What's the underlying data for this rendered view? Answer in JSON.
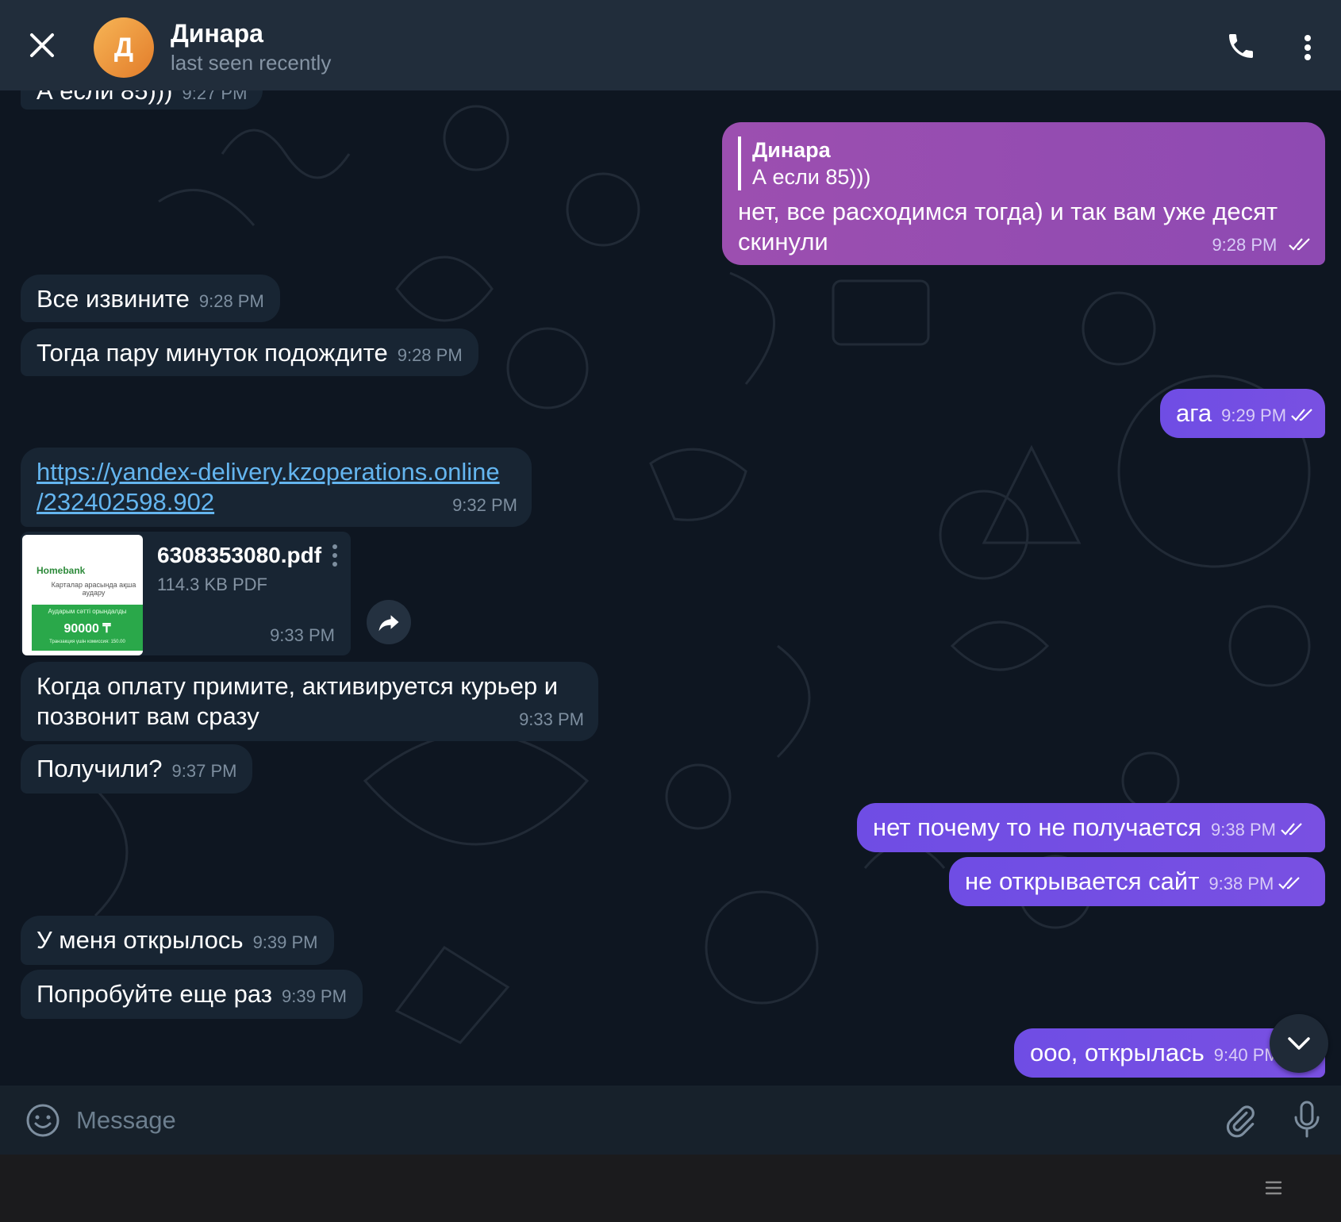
{
  "header": {
    "avatar_letter": "Д",
    "contact_name": "Динара",
    "status": "last seen recently"
  },
  "messages": [
    {
      "dir": "in",
      "text": "А если 85)))",
      "time": "9:27 PM"
    },
    {
      "dir": "out",
      "reply_name": "Динара",
      "reply_text": "А если 85)))",
      "text": "нет, все расходимся тогда) и так вам уже десят скинули",
      "time": "9:28 PM"
    },
    {
      "dir": "in",
      "text": "Все извините",
      "time": "9:28 PM"
    },
    {
      "dir": "in",
      "text": "Тогда пару минуток подождите",
      "time": "9:28 PM"
    },
    {
      "dir": "out",
      "text": "ага",
      "time": "9:29 PM"
    },
    {
      "dir": "in",
      "link_line1": "https://yandex-delivery.kzoperations.online",
      "link_line2": "/232402598.902",
      "time": "9:32 PM"
    },
    {
      "dir": "in",
      "file_name": "6308353080.pdf",
      "file_size": "114.3 KB PDF",
      "time": "9:33 PM",
      "thumb_brand": "Homebank",
      "thumb_text": "Карталар арасында ақша аудару",
      "thumb_status": "Аударым сәтті орындалды",
      "thumb_amount": "90000 ₸",
      "thumb_fee": "Транзакция үшін комиссия: 150.00"
    },
    {
      "dir": "in",
      "text_line1": "Когда оплату примите, активируется курьер и",
      "text_line2": "позвонит вам сразу",
      "time": "9:33 PM"
    },
    {
      "dir": "in",
      "text": "Получили?",
      "time": "9:37 PM"
    },
    {
      "dir": "out",
      "text": "нет почему то не получается",
      "time": "9:38 PM"
    },
    {
      "dir": "out",
      "text": "не открывается сайт",
      "time": "9:38 PM"
    },
    {
      "dir": "in",
      "text": "У меня открылось",
      "time": "9:39 PM"
    },
    {
      "dir": "in",
      "text": "Попробуйте еще раз",
      "time": "9:39 PM"
    },
    {
      "dir": "out",
      "text": "ооо, открылась",
      "time": "9:40 PM"
    }
  ],
  "composer": {
    "placeholder": "Message"
  },
  "colors": {
    "chat_bg": "#0e1621",
    "header_bg": "#212d3b",
    "incoming_bubble": "#182533",
    "outgoing_bubble": "#7950e2",
    "reply_bubble": "#9c4fb0",
    "link": "#64b5ef"
  }
}
